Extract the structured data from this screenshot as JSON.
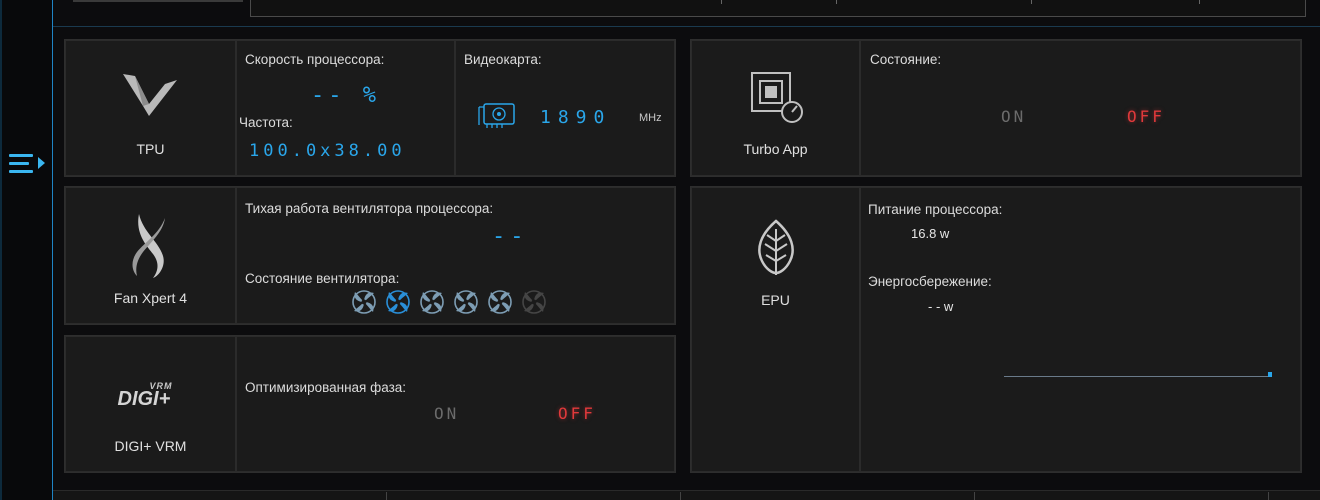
{
  "nav": {
    "menu_icon": "hamburger-menu-icon"
  },
  "tpu": {
    "title": "TPU",
    "icon": "tpu-v-icon",
    "cpu_speed_label": "Скорость процессора:",
    "cpu_speed_value": "-- %",
    "freq_label": "Частота:",
    "freq_value": "100.0x38.00",
    "gpu_label": "Видеокарта:",
    "gpu_icon": "graphics-card-icon",
    "gpu_value": "1890",
    "gpu_unit": "MHz"
  },
  "turbo_app": {
    "title": "Turbo App",
    "icon": "turbo-app-icon",
    "state_label": "Состояние:",
    "on_label": "ON",
    "off_label": "OFF"
  },
  "fan_xpert": {
    "title": "Fan Xpert 4",
    "icon": "fan-xpert-icon",
    "quiet_label": "Тихая работа вентилятора процессора:",
    "quiet_value": "--",
    "fan_state_label": "Состояние вентилятора:",
    "fan_icons": [
      "fan-icon",
      "fan-icon",
      "fan-icon",
      "fan-icon",
      "fan-icon",
      "fan-icon"
    ],
    "fan_colors": [
      "#7d9db4",
      "#2a8fd8",
      "#7d9db4",
      "#7d9db4",
      "#7d9db4",
      "#454545"
    ]
  },
  "epu": {
    "title": "EPU",
    "icon": "leaf-icon",
    "cpu_power_label": "Питание процессора:",
    "cpu_power_value": "16.8 w",
    "saving_label": "Энергосбережение:",
    "saving_value": "- - w"
  },
  "digi": {
    "title": "DIGI+ VRM",
    "icon": "digi-vrm-logo",
    "logo_main": "DIGI+",
    "logo_sup": "VRM",
    "phase_label": "Оптимизированная фаза:",
    "on_label": "ON",
    "off_label": "OFF"
  },
  "colors": {
    "accent": "#2aa6ea",
    "off": "#e0393b",
    "on_dim": "#6b6b6b"
  }
}
